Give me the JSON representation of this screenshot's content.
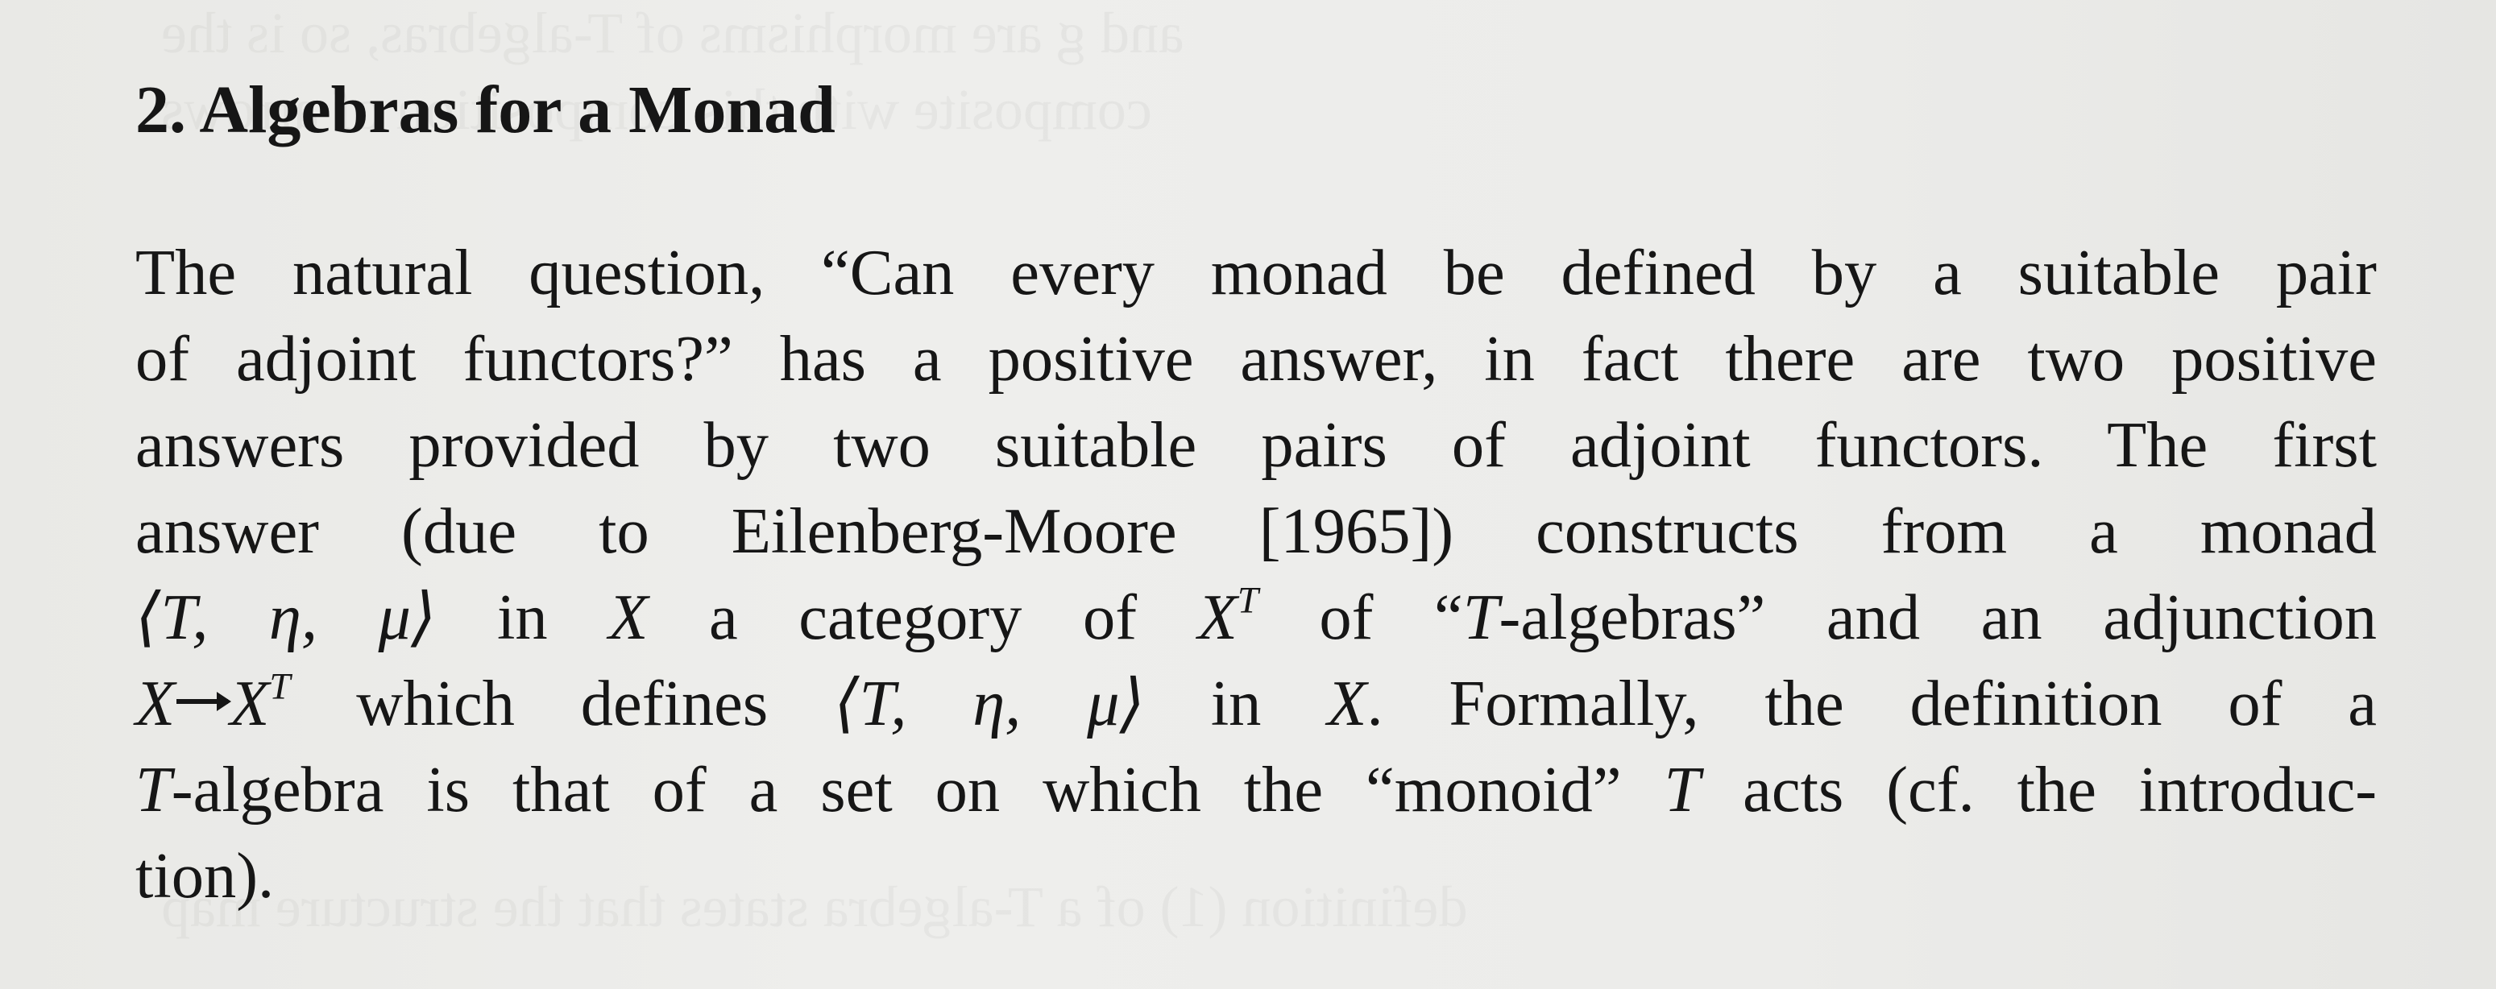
{
  "document": {
    "heading": "2. Algebras for a Monad",
    "paragraph_lines": [
      [
        "The natural question, “Can every monad be defined by a suitable pair"
      ],
      [
        "of adjoint functors?” has a positive answer, in fact there are two positive"
      ],
      [
        "answers provided by two suitable pairs of adjoint functors. The first"
      ],
      [
        "answer (due to Eilenberg-Moore [1965]) constructs from a monad"
      ],
      [
        "in",
        "a category of",
        "of “",
        "-algebras” and an adjunction"
      ],
      [
        "which defines",
        "in",
        ". Formally, the definition of a"
      ],
      [
        "-algebra is that of a set on which the “monoid”",
        "acts (cf. the introduc-"
      ],
      [
        "tion)."
      ]
    ],
    "math": {
      "triple": "⟨T, η, μ⟩",
      "X": "X",
      "T": "T",
      "XT_base": "X",
      "XT_sup": "T"
    }
  }
}
